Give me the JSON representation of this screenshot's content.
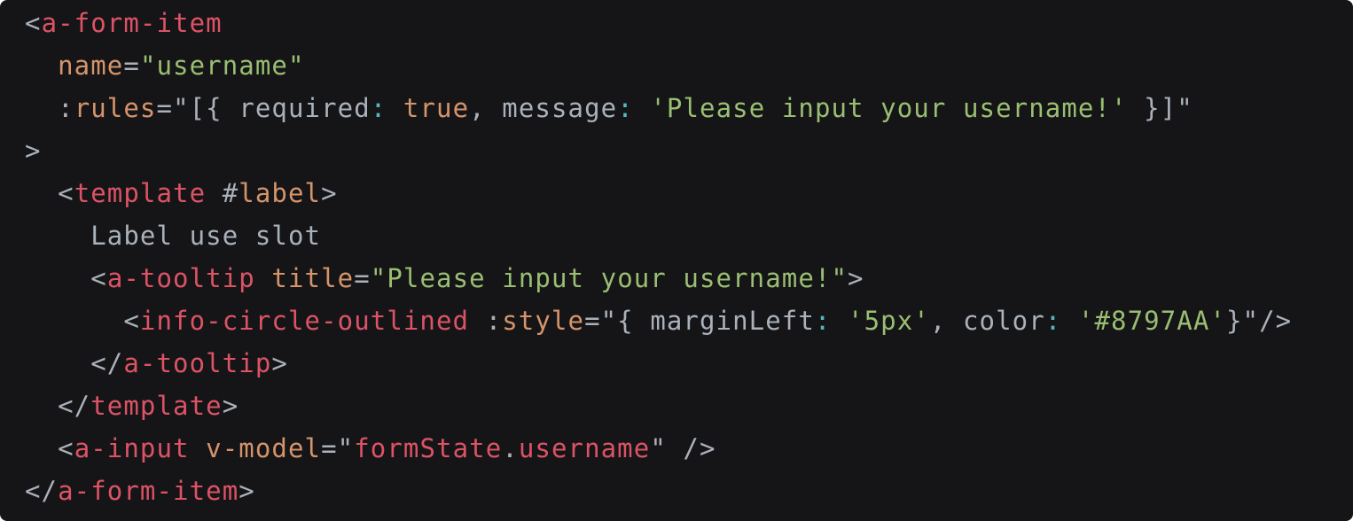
{
  "theme": {
    "background": "#151517",
    "colors": {
      "punct": "#aab1bb",
      "tag": "#dc5366",
      "attr": "#d5946a",
      "string": "#9abe72",
      "keyword": "#56b6c2",
      "plain": "#aab1bb",
      "literal": "#d5946a"
    }
  },
  "code": {
    "lines": [
      [
        {
          "t": "<",
          "k": "punct"
        },
        {
          "t": "a-form-item",
          "k": "tag"
        }
      ],
      [
        {
          "t": "  ",
          "k": "plain"
        },
        {
          "t": "name",
          "k": "attr"
        },
        {
          "t": "=",
          "k": "punct"
        },
        {
          "t": "\"username\"",
          "k": "string"
        }
      ],
      [
        {
          "t": "  ",
          "k": "plain"
        },
        {
          "t": ":",
          "k": "punct"
        },
        {
          "t": "rules",
          "k": "attr"
        },
        {
          "t": "=",
          "k": "punct"
        },
        {
          "t": "\"[{ ",
          "k": "punct"
        },
        {
          "t": "required",
          "k": "plain"
        },
        {
          "t": ": ",
          "k": "keyword"
        },
        {
          "t": "true",
          "k": "literal"
        },
        {
          "t": ", ",
          "k": "punct"
        },
        {
          "t": "message",
          "k": "plain"
        },
        {
          "t": ": ",
          "k": "keyword"
        },
        {
          "t": "'Please input your username!'",
          "k": "string"
        },
        {
          "t": " }]\"",
          "k": "punct"
        }
      ],
      [
        {
          "t": ">",
          "k": "punct"
        }
      ],
      [
        {
          "t": "  ",
          "k": "plain"
        },
        {
          "t": "<",
          "k": "punct"
        },
        {
          "t": "template",
          "k": "tag"
        },
        {
          "t": " ",
          "k": "plain"
        },
        {
          "t": "#",
          "k": "punct"
        },
        {
          "t": "label",
          "k": "attr"
        },
        {
          "t": ">",
          "k": "punct"
        }
      ],
      [
        {
          "t": "    Label use slot",
          "k": "plain"
        }
      ],
      [
        {
          "t": "    ",
          "k": "plain"
        },
        {
          "t": "<",
          "k": "punct"
        },
        {
          "t": "a-tooltip",
          "k": "tag"
        },
        {
          "t": " ",
          "k": "plain"
        },
        {
          "t": "title",
          "k": "attr"
        },
        {
          "t": "=",
          "k": "punct"
        },
        {
          "t": "\"Please input your username!\"",
          "k": "string"
        },
        {
          "t": ">",
          "k": "punct"
        }
      ],
      [
        {
          "t": "      ",
          "k": "plain"
        },
        {
          "t": "<",
          "k": "punct"
        },
        {
          "t": "info-circle-outlined",
          "k": "tag"
        },
        {
          "t": " ",
          "k": "plain"
        },
        {
          "t": ":",
          "k": "punct"
        },
        {
          "t": "style",
          "k": "attr"
        },
        {
          "t": "=",
          "k": "punct"
        },
        {
          "t": "\"{ ",
          "k": "punct"
        },
        {
          "t": "marginLeft",
          "k": "plain"
        },
        {
          "t": ": ",
          "k": "keyword"
        },
        {
          "t": "'5px'",
          "k": "string"
        },
        {
          "t": ", ",
          "k": "punct"
        },
        {
          "t": "color",
          "k": "plain"
        },
        {
          "t": ": ",
          "k": "keyword"
        },
        {
          "t": "'#8797AA'",
          "k": "string"
        },
        {
          "t": "}\"/>",
          "k": "punct"
        }
      ],
      [
        {
          "t": "    ",
          "k": "plain"
        },
        {
          "t": "</",
          "k": "punct"
        },
        {
          "t": "a-tooltip",
          "k": "tag"
        },
        {
          "t": ">",
          "k": "punct"
        }
      ],
      [
        {
          "t": "  ",
          "k": "plain"
        },
        {
          "t": "</",
          "k": "punct"
        },
        {
          "t": "template",
          "k": "tag"
        },
        {
          "t": ">",
          "k": "punct"
        }
      ],
      [
        {
          "t": "  ",
          "k": "plain"
        },
        {
          "t": "<",
          "k": "punct"
        },
        {
          "t": "a-input",
          "k": "tag"
        },
        {
          "t": " ",
          "k": "plain"
        },
        {
          "t": "v-model",
          "k": "attr"
        },
        {
          "t": "=",
          "k": "punct"
        },
        {
          "t": "\"",
          "k": "punct"
        },
        {
          "t": "formState",
          "k": "tag"
        },
        {
          "t": ".",
          "k": "punct"
        },
        {
          "t": "username",
          "k": "tag"
        },
        {
          "t": "\" />",
          "k": "punct"
        }
      ],
      [
        {
          "t": "</",
          "k": "punct"
        },
        {
          "t": "a-form-item",
          "k": "tag"
        },
        {
          "t": ">",
          "k": "punct"
        }
      ]
    ]
  }
}
